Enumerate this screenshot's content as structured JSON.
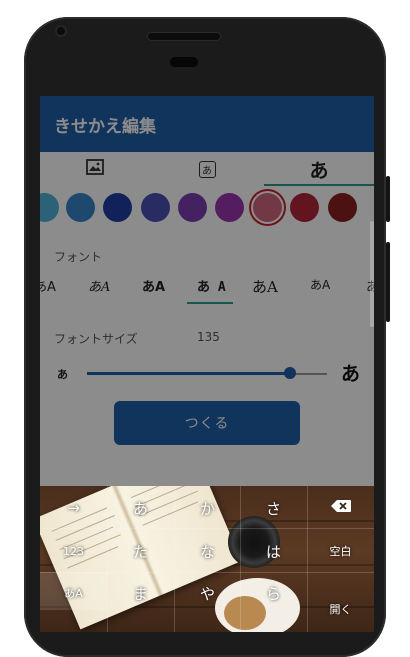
{
  "app": {
    "title": "きせかえ編集"
  },
  "tabs": [
    {
      "id": "background",
      "icon": "image-icon"
    },
    {
      "id": "font-style",
      "icon": "font-box-icon",
      "glyph": "あ"
    },
    {
      "id": "hiragana",
      "label": "あ",
      "selected": true
    }
  ],
  "colors": {
    "accent": "#1f5fa8",
    "indicator": "#2a9d8f",
    "selected_ring": "#c8212f",
    "swatches": [
      "#4fb3d9",
      "#3a83c9",
      "#1f3ea7",
      "#4c4fb5",
      "#7d3fb1",
      "#9a36ae",
      "#d0677e",
      "#b2253a",
      "#8a1f1f"
    ],
    "selected_swatch_index": 6
  },
  "font_section": {
    "label": "フォント",
    "samples": [
      "あA",
      "あA",
      "あA",
      "あ A",
      "あA",
      "あA",
      "あ"
    ],
    "selected_index": 3
  },
  "font_size": {
    "label": "フォントサイズ",
    "value": "135",
    "small_glyph": "あ",
    "large_glyph": "あ",
    "level_fraction": 0.85
  },
  "create_button": {
    "label": "つくる"
  },
  "keyboard": {
    "rows": [
      [
        "→",
        "あ",
        "か",
        "さ",
        "⌫"
      ],
      [
        "123",
        "た",
        "な",
        "は",
        "空白"
      ],
      [
        "あA",
        "ま",
        "や",
        "ら",
        "開く"
      ]
    ]
  }
}
